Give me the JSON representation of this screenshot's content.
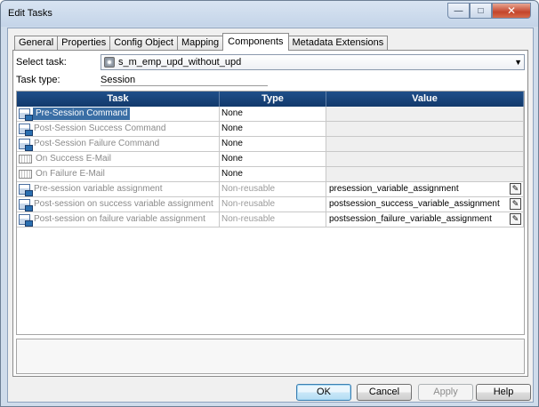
{
  "window": {
    "title": "Edit Tasks"
  },
  "caption_buttons": {
    "minimize": "—",
    "maximize": "□",
    "close": "✕"
  },
  "tabs": [
    {
      "label": "General",
      "active": false
    },
    {
      "label": "Properties",
      "active": false
    },
    {
      "label": "Config Object",
      "active": false
    },
    {
      "label": "Mapping",
      "active": false
    },
    {
      "label": "Components",
      "active": true
    },
    {
      "label": "Metadata Extensions",
      "active": false
    }
  ],
  "select_task": {
    "label": "Select task:",
    "value": "s_m_emp_upd_without_upd",
    "icon": "session-gear-icon"
  },
  "task_type": {
    "label": "Task type:",
    "value": "Session"
  },
  "grid": {
    "headers": {
      "task": "Task",
      "type": "Type",
      "value": "Value"
    },
    "rows": [
      {
        "task": "Pre-Session Command",
        "type": "None",
        "value": "",
        "icon": "command-icon",
        "selected": true,
        "type_dim": false,
        "editable": false
      },
      {
        "task": "Post-Session Success Command",
        "type": "None",
        "value": "",
        "icon": "command-icon",
        "selected": false,
        "type_dim": false,
        "editable": false
      },
      {
        "task": "Post-Session Failure Command",
        "type": "None",
        "value": "",
        "icon": "command-icon",
        "selected": false,
        "type_dim": false,
        "editable": false
      },
      {
        "task": "On Success E-Mail",
        "type": "None",
        "value": "",
        "icon": "email-icon",
        "selected": false,
        "type_dim": false,
        "editable": false
      },
      {
        "task": "On Failure E-Mail",
        "type": "None",
        "value": "",
        "icon": "email-icon",
        "selected": false,
        "type_dim": false,
        "editable": false
      },
      {
        "task": "Pre-session variable assignment",
        "type": "Non-reusable",
        "value": "presession_variable_assignment",
        "icon": "command-icon",
        "selected": false,
        "type_dim": true,
        "editable": true
      },
      {
        "task": "Post-session on success variable assignment",
        "type": "Non-reusable",
        "value": "postsession_success_variable_assignment",
        "icon": "command-icon",
        "selected": false,
        "type_dim": true,
        "editable": true
      },
      {
        "task": "Post-session on failure variable assignment",
        "type": "Non-reusable",
        "value": "postsession_failure_variable_assignment",
        "icon": "command-icon",
        "selected": false,
        "type_dim": true,
        "editable": true
      }
    ]
  },
  "buttons": {
    "ok": "OK",
    "cancel": "Cancel",
    "apply": "Apply",
    "help": "Help"
  },
  "colors": {
    "header_bg": "#1f4f8a",
    "selection": "#3a6ea5"
  }
}
